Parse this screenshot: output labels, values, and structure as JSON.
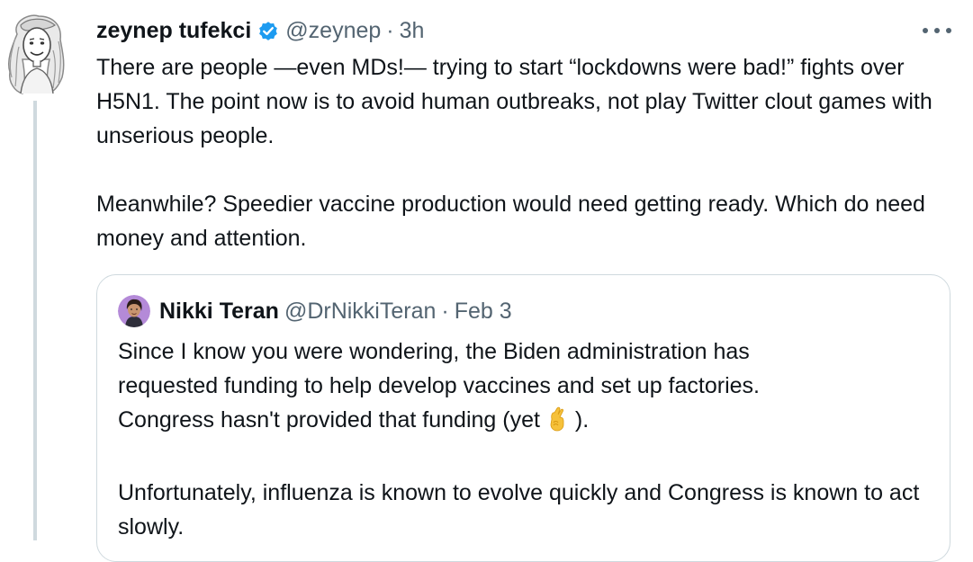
{
  "tweet": {
    "author_name": "zeynep tufekci",
    "handle": "@zeynep",
    "separator": "·",
    "time": "3h",
    "paragraphs": [
      "There are people —even MDs!— trying to start “lockdowns were bad!” fights over H5N1. The point now is to avoid human outbreaks, not play Twitter clout games with unserious people.",
      "Meanwhile? Speedier vaccine production would need getting ready. Which do need money and attention."
    ]
  },
  "quoted_tweet": {
    "author_name": "Nikki Teran",
    "handle": "@DrNikkiTeran",
    "separator": "·",
    "time": "Feb 3",
    "para1_line1": "Since I know you were wondering, the Biden administration has",
    "para1_line2": "requested funding to help develop vaccines and set up factories.",
    "para1_line3_before": "Congress hasn't provided that funding (yet ",
    "emoji": "🤞",
    "para1_line3_after": ").",
    "para2": "Unfortunately, influenza is known to evolve quickly and Congress is known to act slowly."
  },
  "icons": {
    "verified": "verified-badge-icon",
    "more": "more-options-icon",
    "fingers_crossed": "crossed-fingers-emoji"
  },
  "colors": {
    "text": "#0f1419",
    "secondary": "#536471",
    "verified": "#1d9bf0",
    "border": "#cfd9de",
    "emoji": "#f6c13a"
  }
}
